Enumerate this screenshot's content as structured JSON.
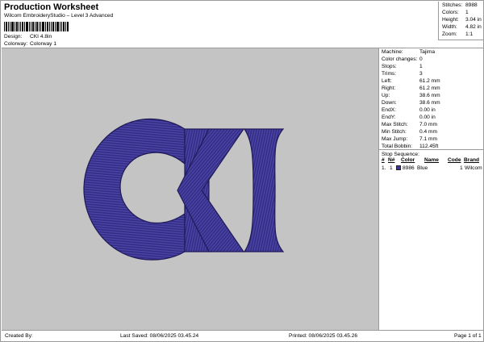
{
  "header": {
    "title": "Production Worksheet",
    "subtitle": "Wilcom EmbroideryStudio – Level 3 Advanced",
    "design_label": "Design:",
    "design_value": "CKI 4.8in",
    "colorway_label": "Colorway:",
    "colorway_value": "Colorway 1"
  },
  "stats": [
    {
      "label": "Stitches:",
      "value": "8988"
    },
    {
      "label": "Colors:",
      "value": "1"
    },
    {
      "label": "Height:",
      "value": "3.04 in"
    },
    {
      "label": "Width:",
      "value": "4.82 in"
    },
    {
      "label": "Zoom:",
      "value": "1:1"
    }
  ],
  "info": [
    {
      "label": "Machine:",
      "value": "Tajima"
    },
    {
      "label": "Color changes:",
      "value": "0"
    },
    {
      "label": "Stops:",
      "value": "1"
    },
    {
      "label": "Trims:",
      "value": "3"
    },
    {
      "label": "Left:",
      "value": "61.2 mm"
    },
    {
      "label": "Right:",
      "value": "61.2 mm"
    },
    {
      "label": "Up:",
      "value": "38.6 mm"
    },
    {
      "label": "Down:",
      "value": "38.6 mm"
    },
    {
      "label": "EndX:",
      "value": "0.00 in"
    },
    {
      "label": "EndY:",
      "value": "0.00 in"
    },
    {
      "label": "Max Stitch:",
      "value": "7.0 mm"
    },
    {
      "label": "Min Stitch:",
      "value": "0.4 mm"
    },
    {
      "label": "Max Jump:",
      "value": "7.1 mm"
    },
    {
      "label": "Total Bobbin:",
      "value": "112.45ft"
    }
  ],
  "stop_sequence": {
    "title": "Stop Sequence:",
    "columns": [
      "#",
      "N#",
      "Color",
      "Name",
      "Code",
      "Brand"
    ],
    "rows": [
      {
        "index": "1.",
        "needle": "1",
        "stitches": "8986",
        "name": "Blue",
        "code": "1",
        "brand": "Wilcom",
        "color": "#3b3592"
      }
    ]
  },
  "design": {
    "thread_color": "#3b3592",
    "background_color": "#c4c4c4"
  },
  "footer": {
    "created_by": "Created By:",
    "last_saved": "Last Saved: 08/06/2025 03.45.24",
    "printed": "Printed: 08/06/2025 03.45.26",
    "page": "Page 1 of 1"
  }
}
